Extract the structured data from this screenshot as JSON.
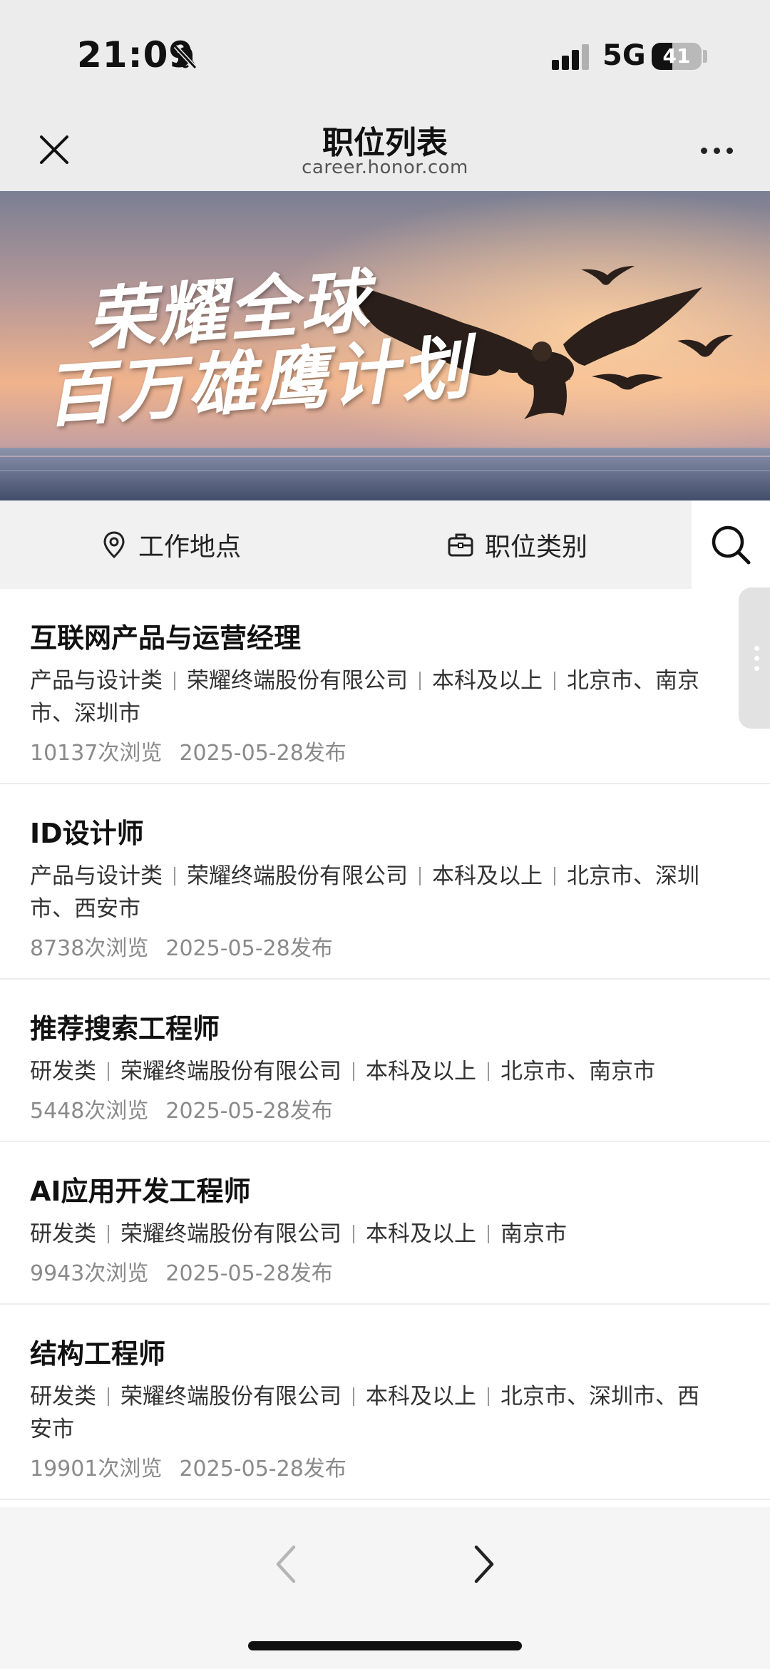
{
  "status_bar": {
    "time": "21:09",
    "network": "5G",
    "battery_level": "41",
    "battery_fraction": 0.41
  },
  "header": {
    "title": "职位列表",
    "subtitle": "career.honor.com"
  },
  "banner": {
    "line1": "荣耀全球",
    "line2": "百万雄鹰计划"
  },
  "filters": {
    "location_label": "工作地点",
    "category_label": "职位类别"
  },
  "jobs": [
    {
      "title": "互联网产品与运营经理",
      "category": "产品与设计类",
      "company": "荣耀终端股份有限公司",
      "education": "本科及以上",
      "locations": "北京市、南京市、深圳市",
      "views": "10137次浏览",
      "published": "2025-05-28发布"
    },
    {
      "title": "ID设计师",
      "category": "产品与设计类",
      "company": "荣耀终端股份有限公司",
      "education": "本科及以上",
      "locations": "北京市、深圳市、西安市",
      "views": "8738次浏览",
      "published": "2025-05-28发布"
    },
    {
      "title": "推荐搜索工程师",
      "category": "研发类",
      "company": "荣耀终端股份有限公司",
      "education": "本科及以上",
      "locations": "北京市、南京市",
      "views": "5448次浏览",
      "published": "2025-05-28发布"
    },
    {
      "title": "AI应用开发工程师",
      "category": "研发类",
      "company": "荣耀终端股份有限公司",
      "education": "本科及以上",
      "locations": "南京市",
      "views": "9943次浏览",
      "published": "2025-05-28发布"
    },
    {
      "title": "结构工程师",
      "category": "研发类",
      "company": "荣耀终端股份有限公司",
      "education": "本科及以上",
      "locations": "北京市、深圳市、西安市",
      "views": "19901次浏览",
      "published": "2025-05-28发布"
    }
  ],
  "icons": {
    "close": "close-icon",
    "more": "more-icon",
    "location": "location-pin-icon",
    "category": "briefcase-icon",
    "search": "search-icon",
    "prev": "chevron-left-icon",
    "next": "chevron-right-icon"
  }
}
